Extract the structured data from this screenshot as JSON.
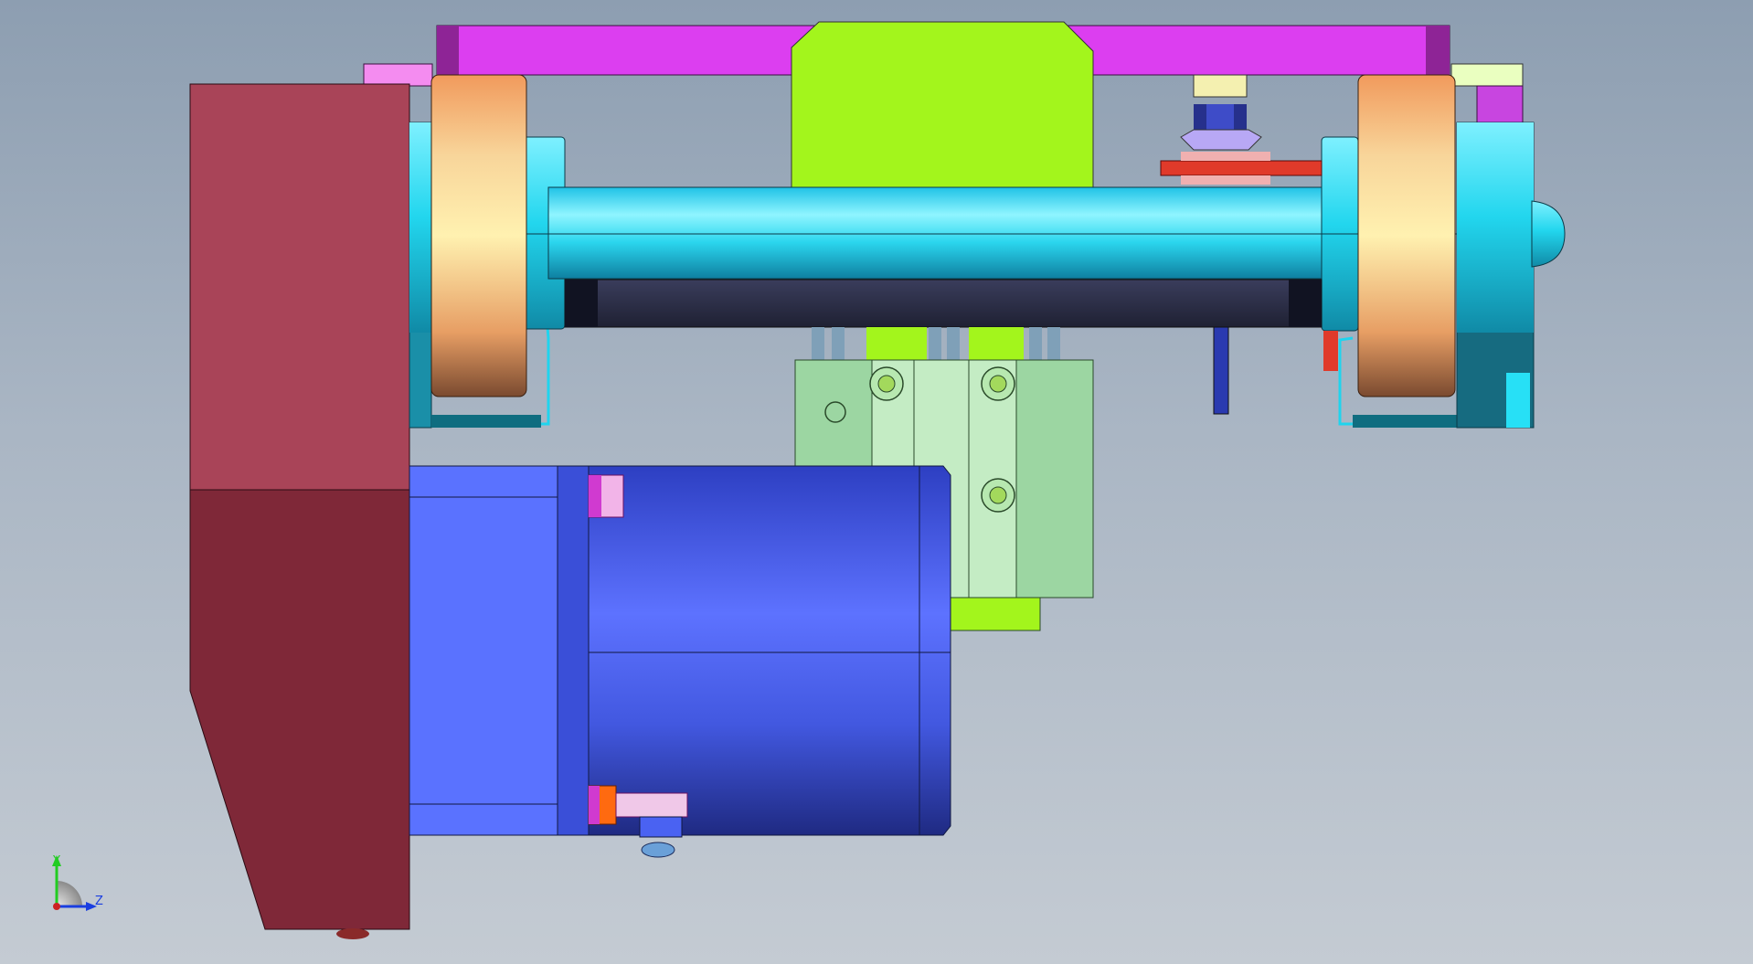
{
  "viewport": {
    "background_top": "#8d9eb1",
    "background_bottom": "#c4cbd3"
  },
  "triad": {
    "y_label": "Y",
    "z_label": "Z",
    "y_color": "#22cc22",
    "z_color": "#1a3ee0",
    "origin_color": "#cc2222"
  },
  "parts": {
    "bracket_color": "#dc3ef0",
    "block_color": "#a3f51c",
    "shaft_color": "#2fd9f0",
    "wheel_color": "#f2b26b",
    "motor_color": "#4a62f2",
    "plate_color": "#a94458",
    "cylinder_color": "#9cd6a2",
    "rail_color": "#2e3150"
  }
}
